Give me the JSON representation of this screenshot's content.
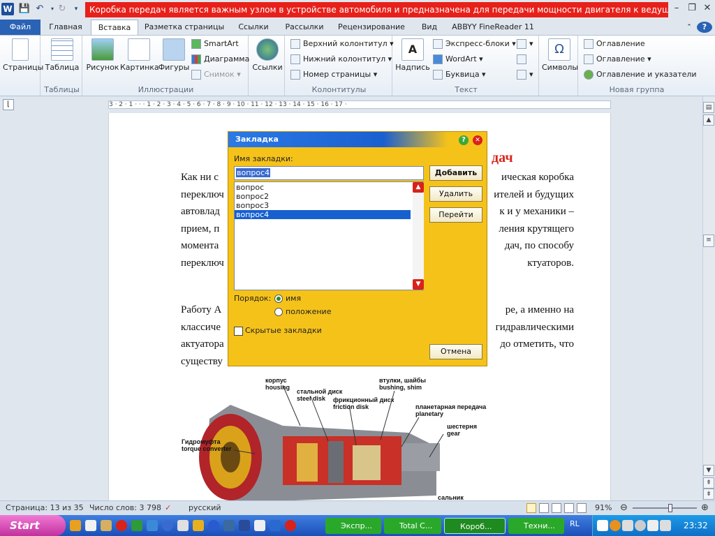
{
  "window": {
    "title": "Коробка передач является важным узлом в устройстве автомобиля и предназначена для передачи мощности двигателя к ведущим колесам [Ре...",
    "logo_letter": "W"
  },
  "tabs": [
    {
      "label": "Файл"
    },
    {
      "label": "Главная"
    },
    {
      "label": "Вставка"
    },
    {
      "label": "Разметка страницы"
    },
    {
      "label": "Ссылки"
    },
    {
      "label": "Рассылки"
    },
    {
      "label": "Рецензирование"
    },
    {
      "label": "Вид"
    },
    {
      "label": "ABBYY FineReader 11"
    }
  ],
  "ribbon": {
    "pages": {
      "label": "Страницы"
    },
    "tables": {
      "button": "Таблица",
      "group": "Таблицы"
    },
    "illustrations": {
      "picture": "Рисунок",
      "clipart": "Картинка",
      "shapes": "Фигуры",
      "smartart": "SmartArt",
      "chart": "Диаграмма",
      "screenshot": "Снимок",
      "group": "Иллюстрации"
    },
    "links": {
      "button": "Ссылки"
    },
    "headers": {
      "header": "Верхний колонтитул",
      "footer": "Нижний колонтитул",
      "page_number": "Номер страницы",
      "group": "Колонтитулы"
    },
    "text": {
      "textbox": "Надпись",
      "quickparts": "Экспресс-блоки",
      "wordart": "WordArt",
      "dropcap": "Буквица",
      "group": "Текст"
    },
    "symbols": {
      "button": "Символы"
    },
    "newgroup": {
      "toc1": "Оглавление",
      "toc2": "Оглавление",
      "toc3": "Оглавление и указатели",
      "group": "Новая группа"
    }
  },
  "ruler": {
    "text": "3 · 2 · 1 · · · 1 · 2 · 3 · 4 · 5 · 6 · 7 · 8 · 9 · 10 · 11 · 12 · 13 · 14 · 15 · 16 · 17 ·"
  },
  "document": {
    "heading_tail": "дач",
    "lines": [
      {
        "left": "Как ни с",
        "right": "ическая коробка"
      },
      {
        "left": "переключ",
        "right": "ителей и будущих"
      },
      {
        "left": "автовлад",
        "right": "к и у механики –"
      },
      {
        "left": "прием, п",
        "right": "ления крутящего"
      },
      {
        "left": "момента",
        "right": "дач, по способу"
      },
      {
        "left": "переключ",
        "right": "ктуаторов."
      }
    ],
    "lines2": [
      {
        "left": "Работу А",
        "right": "ре, а именно на"
      },
      {
        "left": "классиче",
        "right": "гидравлическими"
      },
      {
        "left": "актуатора",
        "right": "до отметить, что"
      },
      {
        "left": "существу",
        "right": ""
      }
    ],
    "image_labels": [
      {
        "ru": "корпус",
        "en": "housing"
      },
      {
        "ru": "стальной диск",
        "en": "steel disk"
      },
      {
        "ru": "фрикционный диск",
        "en": "friction disk"
      },
      {
        "ru": "втулки, шайбы",
        "en": "bushing, shim"
      },
      {
        "ru": "планетарная передача",
        "en": "planetary"
      },
      {
        "ru": "шестерня",
        "en": "gear"
      },
      {
        "ru": "Гидромуфта",
        "en": "torque converter"
      },
      {
        "ru": "сальник",
        "en": ""
      }
    ]
  },
  "dialog": {
    "title": "Закладка",
    "name_label": "Имя закладки:",
    "name_value": "вопрос4",
    "items": [
      "вопрос",
      "вопрос2",
      "вопрос3",
      "вопрос4"
    ],
    "selected_index": 3,
    "add": "Добавить",
    "delete": "Удалить",
    "goto": "Перейти",
    "order_label": "Порядок:",
    "order_name": "имя",
    "order_position": "положение",
    "order_selected": "имя",
    "hidden_label": "Скрытые закладки",
    "hidden_checked": false,
    "cancel": "Отмена"
  },
  "status": {
    "page": "Страница: 13 из 35",
    "words": "Число слов: 3 798",
    "language": "русский",
    "zoom": "91%",
    "zoom_fraction": 0.59
  },
  "taskbar": {
    "start": "Start",
    "items": [
      {
        "label": "Экспр..."
      },
      {
        "label": "Total C..."
      },
      {
        "label": "Короб..."
      },
      {
        "label": "Техни..."
      }
    ],
    "lang": "RL",
    "clock": "23:32"
  },
  "colors": {
    "title_highlight": "#e8201a",
    "dialog_bg": "#f5c21a",
    "heading_red": "#d9251d",
    "list_selection": "#1660d0"
  }
}
